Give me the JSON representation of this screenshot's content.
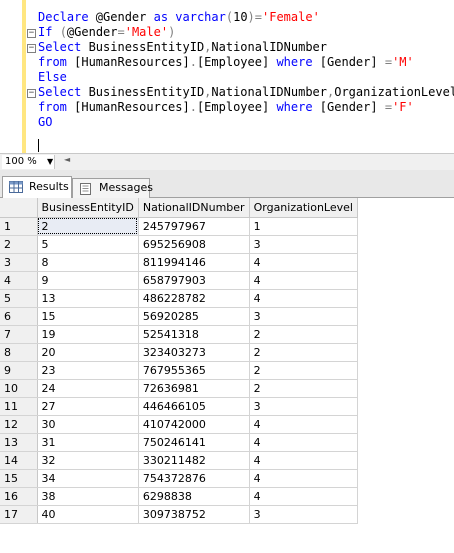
{
  "editor": {
    "lines": [
      [
        {
          "t": "Declare ",
          "c": "kw"
        },
        {
          "t": "@Gender ",
          "c": "txt"
        },
        {
          "t": "as ",
          "c": "kw"
        },
        {
          "t": "varchar",
          "c": "kw"
        },
        {
          "t": "(",
          "c": "op"
        },
        {
          "t": "10",
          "c": "txt"
        },
        {
          "t": ")=",
          "c": "op"
        },
        {
          "t": "'Female'",
          "c": "str"
        }
      ],
      [
        {
          "t": "If ",
          "c": "kw"
        },
        {
          "t": "(",
          "c": "op"
        },
        {
          "t": "@Gender",
          "c": "txt"
        },
        {
          "t": "=",
          "c": "op"
        },
        {
          "t": "'Male'",
          "c": "str"
        },
        {
          "t": ")",
          "c": "op"
        }
      ],
      [
        {
          "t": "Select ",
          "c": "kw"
        },
        {
          "t": "BusinessEntityID",
          "c": "txt"
        },
        {
          "t": ",",
          "c": "op"
        },
        {
          "t": "NationalIDNumber",
          "c": "txt"
        }
      ],
      [
        {
          "t": "from ",
          "c": "kw"
        },
        {
          "t": "[HumanResources]",
          "c": "txt"
        },
        {
          "t": ".",
          "c": "op"
        },
        {
          "t": "[Employee] ",
          "c": "txt"
        },
        {
          "t": "where ",
          "c": "kw"
        },
        {
          "t": "[Gender] ",
          "c": "txt"
        },
        {
          "t": "=",
          "c": "op"
        },
        {
          "t": "'M'",
          "c": "str"
        }
      ],
      [
        {
          "t": "Else",
          "c": "kw"
        }
      ],
      [
        {
          "t": "Select ",
          "c": "kw"
        },
        {
          "t": "BusinessEntityID",
          "c": "txt"
        },
        {
          "t": ",",
          "c": "op"
        },
        {
          "t": "NationalIDNumber",
          "c": "txt"
        },
        {
          "t": ",",
          "c": "op"
        },
        {
          "t": "OrganizationLevel",
          "c": "txt"
        }
      ],
      [
        {
          "t": "from ",
          "c": "kw"
        },
        {
          "t": "[HumanResources]",
          "c": "txt"
        },
        {
          "t": ".",
          "c": "op"
        },
        {
          "t": "[Employee] ",
          "c": "txt"
        },
        {
          "t": "where ",
          "c": "kw"
        },
        {
          "t": "[Gender] ",
          "c": "txt"
        },
        {
          "t": "=",
          "c": "op"
        },
        {
          "t": "'F'",
          "c": "str"
        }
      ],
      [
        {
          "t": "GO",
          "c": "kw"
        }
      ]
    ]
  },
  "zoom": {
    "value": "100 %"
  },
  "tabs": {
    "results": "Results",
    "messages": "Messages"
  },
  "grid": {
    "columns": [
      "BusinessEntityID",
      "NationalIDNumber",
      "OrganizationLevel"
    ],
    "rows": [
      [
        "1",
        "2",
        "245797967",
        "1"
      ],
      [
        "2",
        "5",
        "695256908",
        "3"
      ],
      [
        "3",
        "8",
        "811994146",
        "4"
      ],
      [
        "4",
        "9",
        "658797903",
        "4"
      ],
      [
        "5",
        "13",
        "486228782",
        "4"
      ],
      [
        "6",
        "15",
        "56920285",
        "3"
      ],
      [
        "7",
        "19",
        "52541318",
        "2"
      ],
      [
        "8",
        "20",
        "323403273",
        "2"
      ],
      [
        "9",
        "23",
        "767955365",
        "2"
      ],
      [
        "10",
        "24",
        "72636981",
        "2"
      ],
      [
        "11",
        "27",
        "446466105",
        "3"
      ],
      [
        "12",
        "30",
        "410742000",
        "4"
      ],
      [
        "13",
        "31",
        "750246141",
        "4"
      ],
      [
        "14",
        "32",
        "330211482",
        "4"
      ],
      [
        "15",
        "34",
        "754372876",
        "4"
      ],
      [
        "16",
        "38",
        "6298838",
        "4"
      ],
      [
        "17",
        "40",
        "309738752",
        "3"
      ]
    ]
  }
}
